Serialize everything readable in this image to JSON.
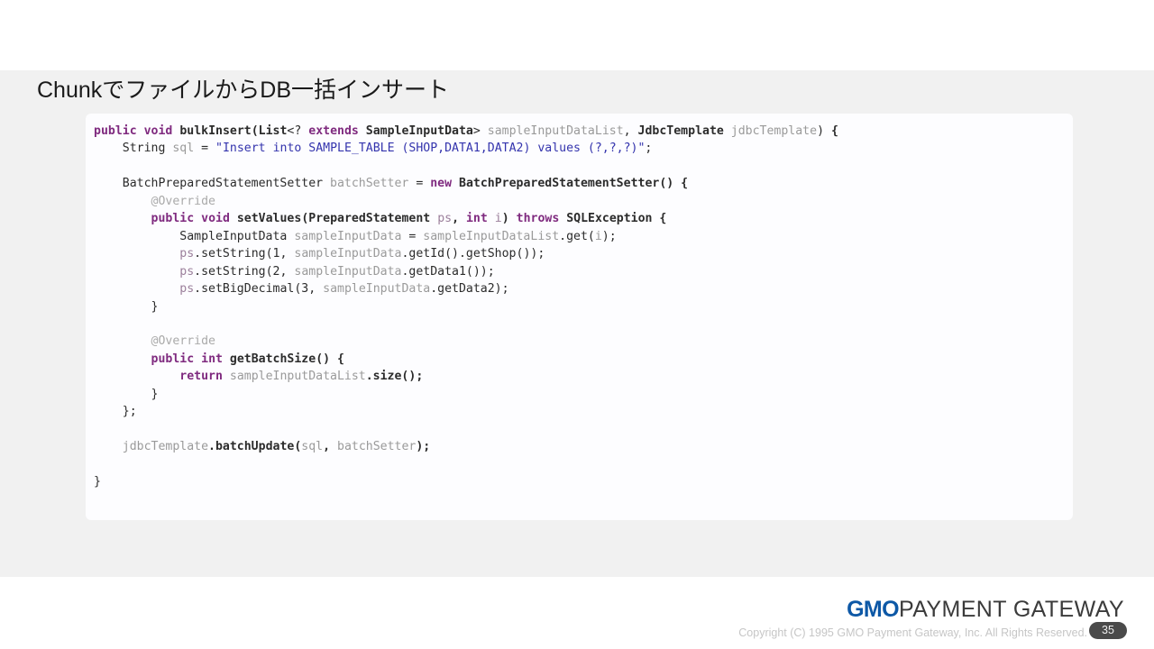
{
  "slide": {
    "title": "ChunkでファイルからDB一括インサート",
    "background_color": "#f1f1f1",
    "frame_color": "#ffffff"
  },
  "code": {
    "language": "java",
    "card_background": "#fdfdff",
    "colors": {
      "keyword": "#7f2a7f",
      "string": "#3434ad",
      "variable": "#9a9a9a",
      "annotation": "#aaaaaa",
      "receiver_variable": "#9b7f9b",
      "default": "#2b2b2b"
    },
    "text": "public void bulkInsert(List<? extends SampleInputData> sampleInputDataList, JdbcTemplate jdbcTemplate) {\n    String sql = \"Insert into SAMPLE_TABLE (SHOP,DATA1,DATA2) values (?,?,?)\";\n\n    BatchPreparedStatementSetter batchSetter = new BatchPreparedStatementSetter() {\n        @Override\n        public void setValues(PreparedStatement ps, int i) throws SQLException {\n            SampleInputData sampleInputData = sampleInputDataList.get(i);\n            ps.setString(1, sampleInputData.getId().getShop());\n            ps.setString(2, sampleInputData.getData1());\n            ps.setBigDecimal(3, sampleInputData.getData2);\n        }\n\n        @Override\n        public int getBatchSize() {\n            return sampleInputDataList.size();\n        }\n    };\n\n    jdbcTemplate.batchUpdate(sql, batchSetter);\n\n}"
  },
  "footer": {
    "logo_primary": "GMO",
    "logo_secondary": "PAYMENT GATEWAY",
    "logo_primary_color": "#0d58a6",
    "logo_secondary_color": "#3b3b3b",
    "copyright": "Copyright (C) 1995 GMO Payment Gateway, Inc. All Rights Reserved.",
    "page_number": "35"
  }
}
